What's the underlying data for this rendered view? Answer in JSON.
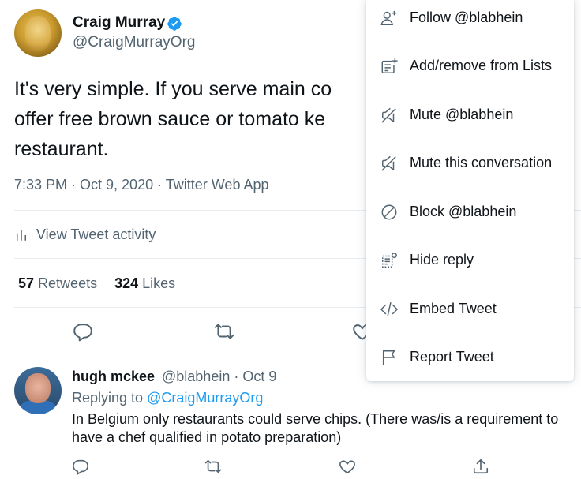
{
  "tweet": {
    "author_name": "Craig Murray",
    "author_handle": "@CraigMurrayOrg",
    "verified": true,
    "text": "It's very simple. If you serve main co\noffer free brown sauce or tomato ke\nrestaurant.",
    "meta": "7:33 PM · Oct 9, 2020 · Twitter Web App",
    "activity_label": "View Tweet activity",
    "retweets_count": "57",
    "retweets_label": "Retweets",
    "likes_count": "324",
    "likes_label": "Likes"
  },
  "reply": {
    "author_name": "hugh mckee",
    "author_handle": "@blabhein · Oct 9",
    "replying_prefix": "Replying to",
    "replying_handle": "@CraigMurrayOrg",
    "text": "In Belgium only restaurants could serve chips. (There was/is a requirement to have a chef qualified in potato preparation)"
  },
  "menu": {
    "items": [
      {
        "label": "Follow @blabhein",
        "icon": "follow-icon"
      },
      {
        "label": "Add/remove from Lists",
        "icon": "list-add-icon"
      },
      {
        "label": "Mute @blabhein",
        "icon": "mute-icon"
      },
      {
        "label": "Mute this conversation",
        "icon": "mute-conversation-icon"
      },
      {
        "label": "Block @blabhein",
        "icon": "block-icon"
      },
      {
        "label": "Hide reply",
        "icon": "hide-reply-icon"
      },
      {
        "label": "Embed Tweet",
        "icon": "embed-icon"
      },
      {
        "label": "Report Tweet",
        "icon": "report-flag-icon"
      }
    ]
  },
  "colors": {
    "primary_text": "#0f1419",
    "secondary_text": "#536471",
    "link_blue": "#1d9bf0",
    "divider": "#e6ecf0"
  }
}
